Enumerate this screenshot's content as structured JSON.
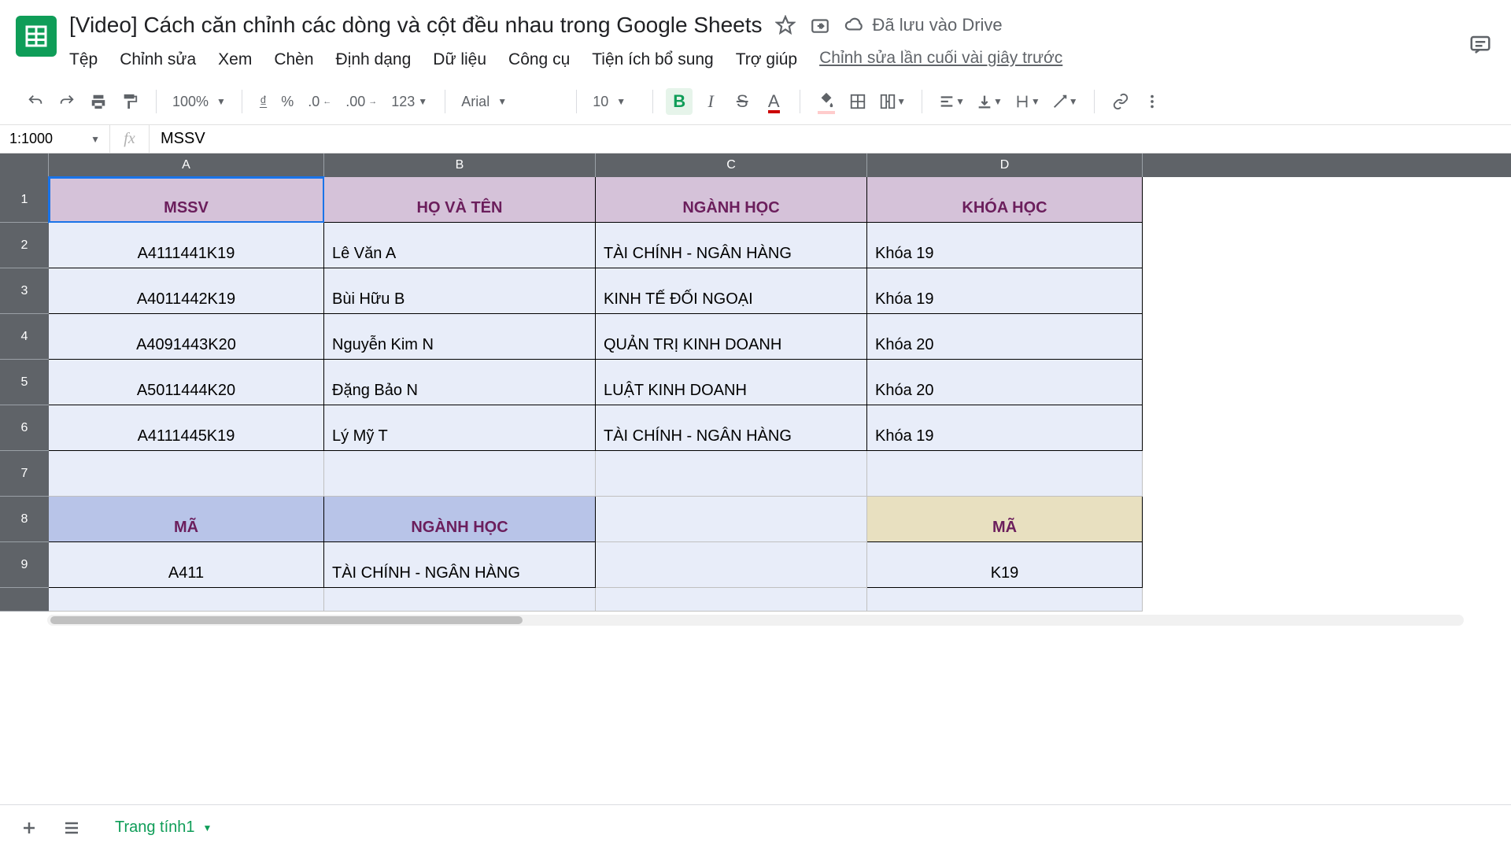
{
  "header": {
    "title": "[Video] Cách căn chỉnh các dòng và cột đều nhau trong Google Sheets",
    "save_status": "Đã lưu vào Drive",
    "menu": [
      "Tệp",
      "Chỉnh sửa",
      "Xem",
      "Chèn",
      "Định dạng",
      "Dữ liệu",
      "Công cụ",
      "Tiện ích bổ sung",
      "Trợ giúp"
    ],
    "last_edit": "Chỉnh sửa lần cuối vài giây trước"
  },
  "toolbar": {
    "zoom": "100%",
    "currency": "₫",
    "percent": "%",
    "dec_dec": ".0",
    "inc_dec": ".00",
    "format": "123",
    "font": "Arial",
    "size": "10",
    "bold": "B",
    "italic": "I",
    "strike": "S",
    "text_color": "A"
  },
  "formula_bar": {
    "name_box": "1:1000",
    "fx": "fx",
    "value": "MSSV"
  },
  "columns": [
    "A",
    "B",
    "C",
    "D"
  ],
  "rows": [
    "1",
    "2",
    "3",
    "4",
    "5",
    "6",
    "7",
    "8",
    "9"
  ],
  "table1": {
    "headers": [
      "MSSV",
      "HỌ VÀ TÊN",
      "NGÀNH HỌC",
      "KHÓA HỌC"
    ],
    "data": [
      [
        "A4111441K19",
        "Lê Văn A",
        "TÀI CHÍNH - NGÂN HÀNG",
        "Khóa 19"
      ],
      [
        "A4011442K19",
        "Bùi Hữu B",
        "KINH TẾ ĐỐI NGOẠI",
        "Khóa 19"
      ],
      [
        "A4091443K20",
        "Nguyễn Kim N",
        "QUẢN TRỊ KINH DOANH",
        "Khóa 20"
      ],
      [
        "A5011444K20",
        "Đặng Bảo N",
        "LUẬT KINH DOANH",
        "Khóa 20"
      ],
      [
        "A4111445K19",
        "Lý Mỹ T",
        "TÀI CHÍNH - NGÂN HÀNG",
        "Khóa 19"
      ]
    ]
  },
  "table2": {
    "headers_left": [
      "MÃ",
      "NGÀNH HỌC"
    ],
    "header_right": "MÃ",
    "data_left": [
      "A411",
      "TÀI CHÍNH - NGÂN HÀNG"
    ],
    "data_right": "K19"
  },
  "sheet_tab": "Trang tính1"
}
